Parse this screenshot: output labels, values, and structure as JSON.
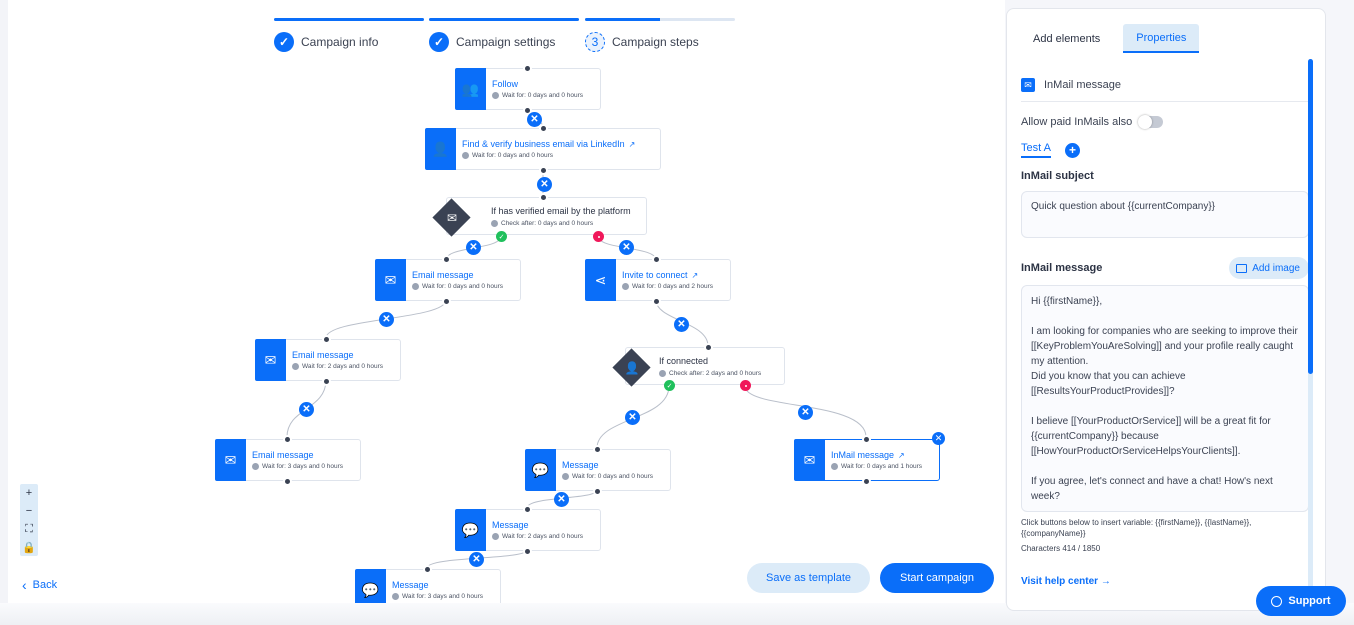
{
  "steps": [
    {
      "label": "Campaign info",
      "state": "done",
      "icon": "check-icon",
      "glyph": "✓"
    },
    {
      "label": "Campaign settings",
      "state": "done",
      "icon": "check-icon",
      "glyph": "✓"
    },
    {
      "label": "Campaign steps",
      "state": "current",
      "number": "3",
      "progress": 0.5
    }
  ],
  "flow": {
    "nodes": [
      {
        "id": "follow",
        "title": "Follow",
        "sub": "Wait for: 0 days and 0 hours",
        "icon": "follow-icon",
        "glyph": "👥",
        "external": false
      },
      {
        "id": "find-email",
        "title": "Find & verify business email via LinkedIn",
        "sub": "Wait for: 0 days and 0 hours",
        "icon": "person-id-icon",
        "glyph": "👤",
        "external": true
      },
      {
        "id": "email-1",
        "title": "Email message",
        "sub": "Wait for: 0 days and 0 hours",
        "icon": "envelope-icon",
        "glyph": "✉",
        "external": false
      },
      {
        "id": "invite",
        "title": "Invite to connect",
        "sub": "Wait for: 0 days and 2 hours",
        "icon": "share-icon",
        "glyph": "⋖",
        "external": true
      },
      {
        "id": "email-2",
        "title": "Email message",
        "sub": "Wait for: 2 days and 0 hours",
        "icon": "envelope-icon",
        "glyph": "✉",
        "external": false
      },
      {
        "id": "email-3",
        "title": "Email message",
        "sub": "Wait for: 3 days and 0 hours",
        "icon": "envelope-icon",
        "glyph": "✉",
        "external": false
      },
      {
        "id": "message-1",
        "title": "Message",
        "sub": "Wait for: 0 days and 0 hours",
        "icon": "chat-bubble-icon",
        "glyph": "💬",
        "external": false
      },
      {
        "id": "inmail",
        "title": "InMail message",
        "sub": "Wait for: 0 days and 1 hours",
        "icon": "envelope-icon",
        "glyph": "✉",
        "external": true,
        "selected": true
      },
      {
        "id": "message-2",
        "title": "Message",
        "sub": "Wait for: 2 days and 0 hours",
        "icon": "chat-bubble-icon",
        "glyph": "💬",
        "external": false
      },
      {
        "id": "message-3",
        "title": "Message",
        "sub": "Wait for: 3 days and 0 hours",
        "icon": "chat-bubble-icon",
        "glyph": "💬",
        "external": false
      }
    ],
    "conditions": [
      {
        "id": "if-email",
        "title": "If has verified email by the platform",
        "sub": "Check after: 0 days and 0 hours",
        "icon": "envelope-icon",
        "glyph": "✉"
      },
      {
        "id": "if-connected",
        "title": "If connected",
        "sub": "Check after: 2 days and 0 hours",
        "icon": "person-check-icon",
        "glyph": "👤"
      }
    ],
    "external_glyph": "↗",
    "delete_glyph": "✕",
    "yes_glyph": "✓"
  },
  "zoom_controls": [
    {
      "name": "zoom-in-button",
      "glyph": "+"
    },
    {
      "name": "zoom-out-button",
      "glyph": "−"
    },
    {
      "name": "fit-view-button",
      "glyph": "⛶"
    },
    {
      "name": "lock-button",
      "glyph": "🔒"
    }
  ],
  "back": {
    "label": "Back",
    "glyph": "‹"
  },
  "actions": {
    "save_template": "Save as template",
    "start_campaign": "Start campaign"
  },
  "panel": {
    "tabs": {
      "add_elements": "Add elements",
      "properties": "Properties"
    },
    "element_title": "InMail message",
    "allow_paid_label": "Allow paid InMails also",
    "allow_paid_on": false,
    "variant_tab": "Test A",
    "variant_add": "+",
    "subject_label": "InMail subject",
    "subject_value": "Quick question about {{currentCompany}}",
    "message_label": "InMail message",
    "add_image": "Add image",
    "message_value": "Hi {{firstName}},\n\nI am looking for companies who are seeking to improve their [[KeyProblemYouAreSolving]] and your profile really caught my attention.\nDid you know that you can achieve [[ResultsYourProductProvides]]?\n\nI believe [[YourProductOrService]] will be a great fit for {{currentCompany}} because [[HowYourProductOrServiceHelpsYourClients]].\n\nIf you agree, let's connect and have a chat! How's next week?",
    "hint": "Click buttons below to insert variable: {{firstName}}, {{lastName}}, {{companyName}}",
    "characters": "Characters 414 / 1850",
    "help_link": "Visit help center →"
  },
  "support": {
    "label": "Support"
  }
}
